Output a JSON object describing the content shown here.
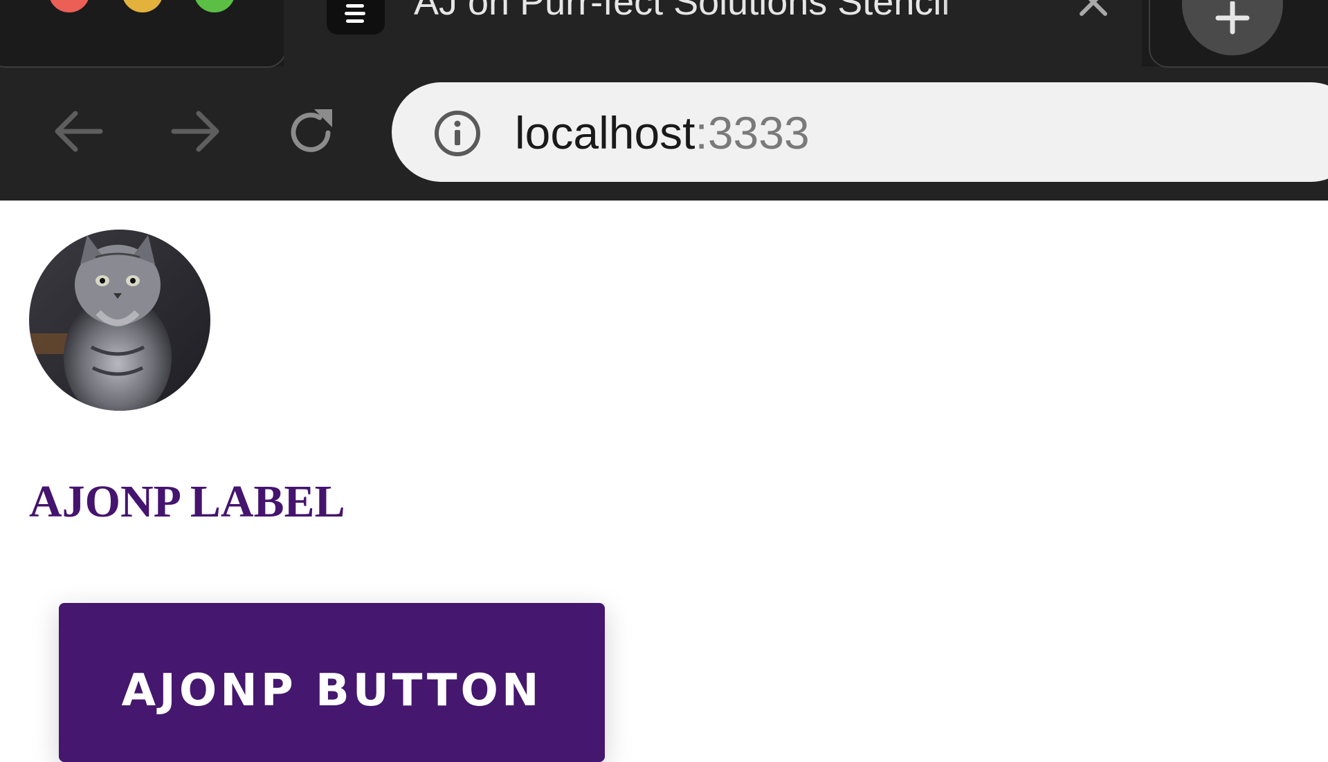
{
  "browser": {
    "tab_title": "AJ on Purr-fect Solutions Stencil",
    "url_host": "localhost",
    "url_port": ":3333"
  },
  "icons": {
    "back": "arrow-left-icon",
    "forward": "arrow-right-icon",
    "reload": "reload-icon",
    "info": "info-icon",
    "close_tab": "close-icon",
    "new_tab": "plus-icon",
    "favicon": "stencil-favicon-icon"
  },
  "colors": {
    "brand_purple": "#45176f",
    "label_purple": "#45146e",
    "chrome_dark": "#232323",
    "omnibox_bg": "#f1f1f1"
  },
  "page": {
    "avatar_alt": "kitten",
    "label": "AJONP LABEL",
    "button": "AJONP BUTTON"
  }
}
